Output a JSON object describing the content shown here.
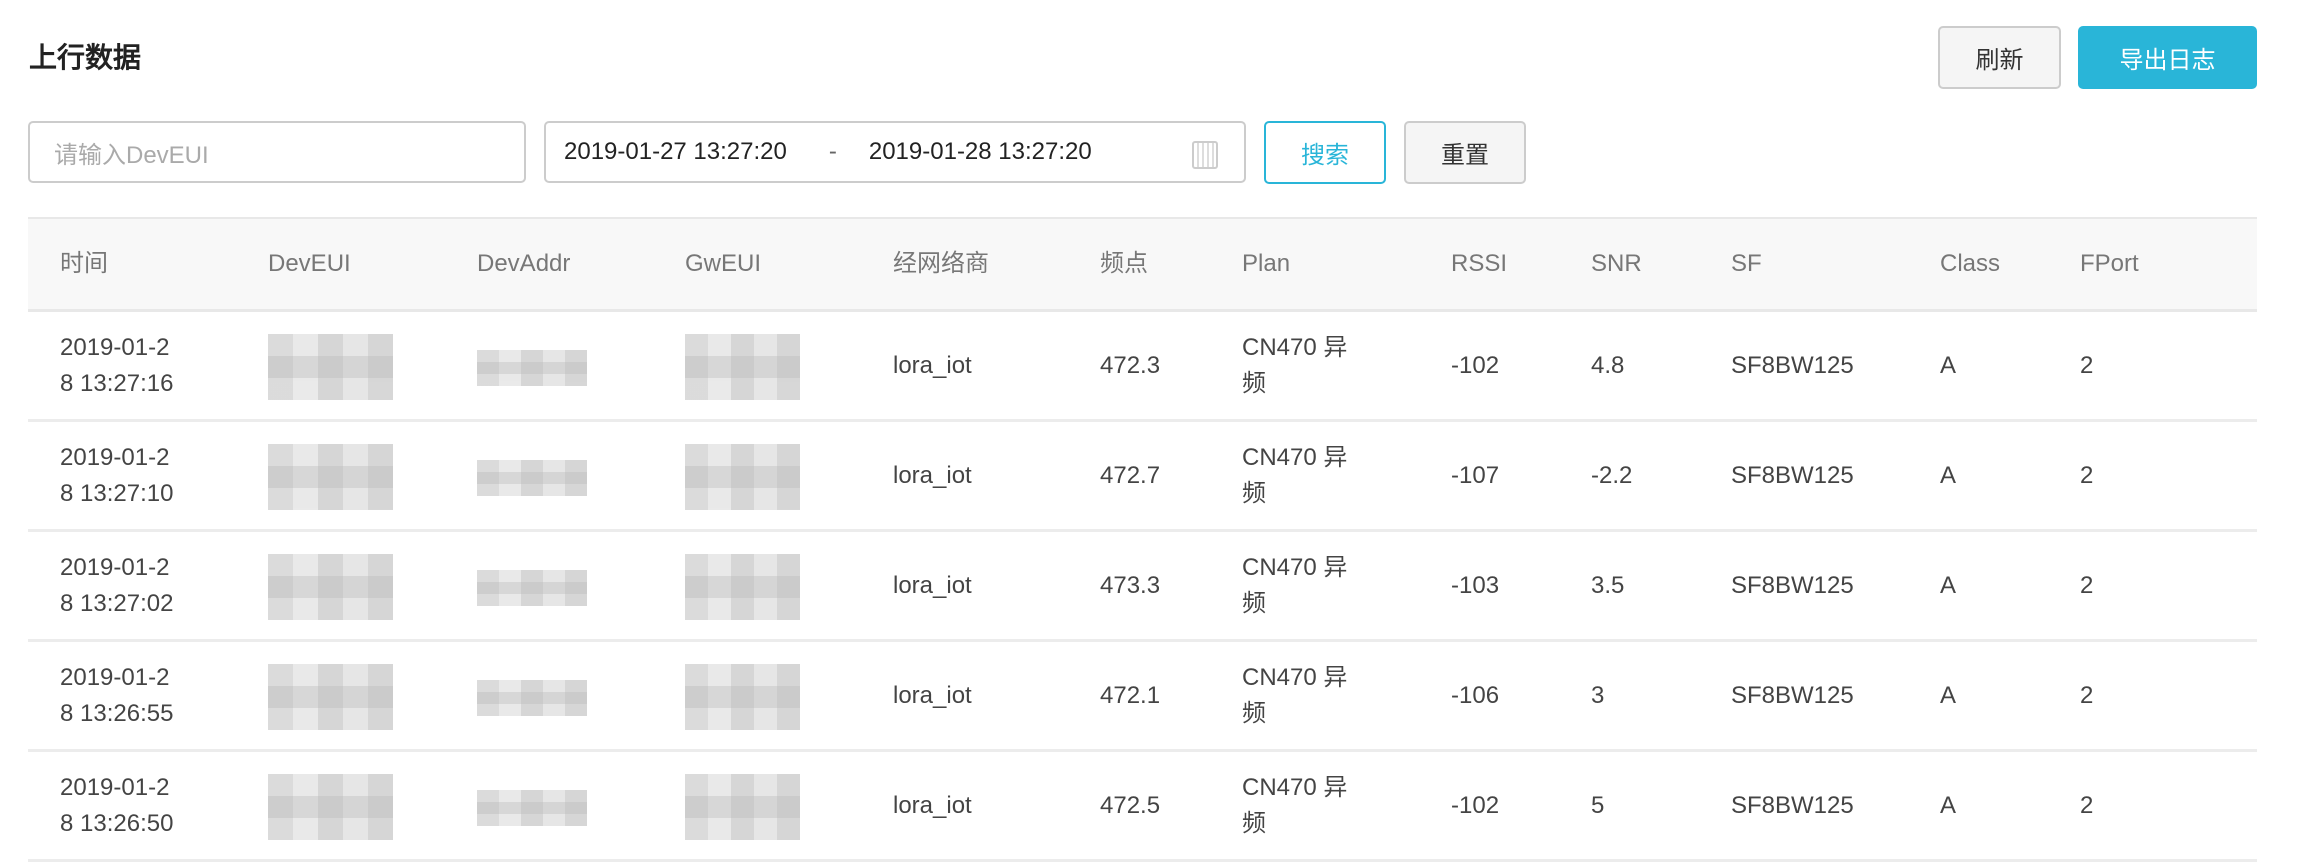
{
  "header": {
    "title": "上行数据",
    "refresh_label": "刷新",
    "export_label": "导出日志"
  },
  "filters": {
    "deveui_placeholder": "请输入DevEUI",
    "start_time": "2019-01-27 13:27:20",
    "separator": "-",
    "end_time": "2019-01-28 13:27:20",
    "search_label": "搜索",
    "reset_label": "重置"
  },
  "table": {
    "columns": [
      "时间",
      "DevEUI",
      "DevAddr",
      "GwEUI",
      "经网络商",
      "频点",
      "Plan",
      "RSSI",
      "SNR",
      "SF",
      "Class",
      "FPort"
    ],
    "rows": [
      {
        "time1": "2019-01-2",
        "time2": "8 13:27:16",
        "operator": "lora_iot",
        "freq": "472.3",
        "plan1": "CN470 异",
        "plan2": "频",
        "rssi": "-102",
        "snr": "4.8",
        "sf": "SF8BW125",
        "class": "A",
        "fport": "2"
      },
      {
        "time1": "2019-01-2",
        "time2": "8 13:27:10",
        "operator": "lora_iot",
        "freq": "472.7",
        "plan1": "CN470 异",
        "plan2": "频",
        "rssi": "-107",
        "snr": "-2.2",
        "sf": "SF8BW125",
        "class": "A",
        "fport": "2"
      },
      {
        "time1": "2019-01-2",
        "time2": "8 13:27:02",
        "operator": "lora_iot",
        "freq": "473.3",
        "plan1": "CN470 异",
        "plan2": "频",
        "rssi": "-103",
        "snr": "3.5",
        "sf": "SF8BW125",
        "class": "A",
        "fport": "2"
      },
      {
        "time1": "2019-01-2",
        "time2": "8 13:26:55",
        "operator": "lora_iot",
        "freq": "472.1",
        "plan1": "CN470 异",
        "plan2": "频",
        "rssi": "-106",
        "snr": "3",
        "sf": "SF8BW125",
        "class": "A",
        "fport": "2"
      },
      {
        "time1": "2019-01-2",
        "time2": "8 13:26:50",
        "operator": "lora_iot",
        "freq": "472.5",
        "plan1": "CN470 异",
        "plan2": "频",
        "rssi": "-102",
        "snr": "5",
        "sf": "SF8BW125",
        "class": "A",
        "fport": "2"
      }
    ]
  }
}
